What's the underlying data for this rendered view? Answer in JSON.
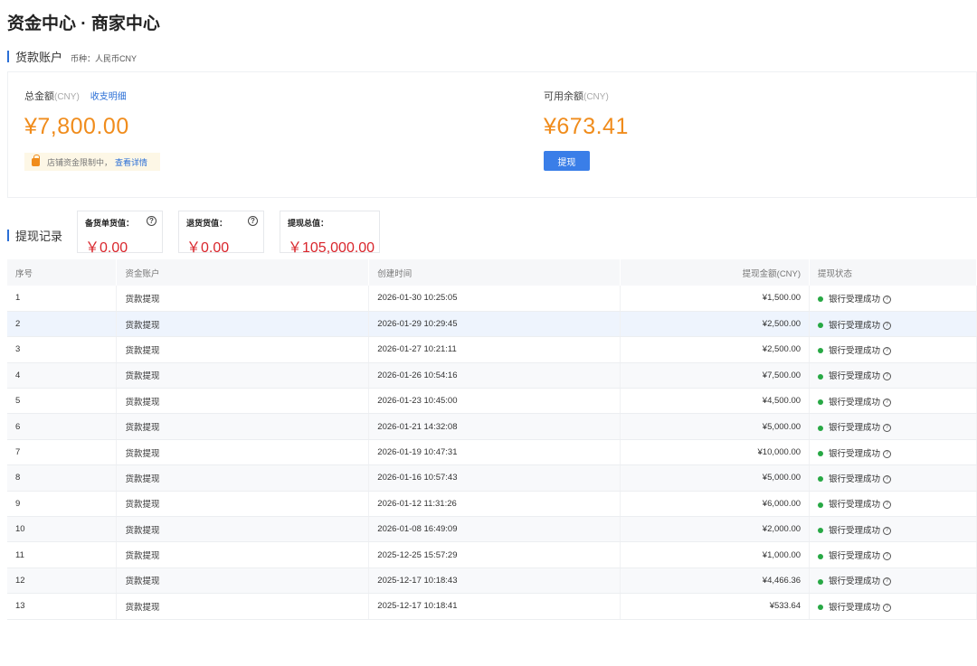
{
  "page": {
    "title": "资金中心 · 商家中心"
  },
  "account": {
    "section_label": "货款账户",
    "currency": "币种：人民币CNY",
    "total": {
      "label": "总金额",
      "unit": "(CNY)",
      "link": "收支明细",
      "amount": "¥7,800.00",
      "notice_text": "店铺资金限制中，",
      "notice_link": "查看详情"
    },
    "available": {
      "label": "可用余额",
      "unit": "(CNY)",
      "amount": "¥673.41",
      "button": "提现"
    }
  },
  "records": {
    "section_label": "提现记录",
    "stats": [
      {
        "label": "备货单货值：",
        "value": "￥0.00",
        "help": "?"
      },
      {
        "label": "退货货值：",
        "value": "￥0.00",
        "help": "?"
      },
      {
        "label": "提现总值：",
        "value": "￥105,000.00"
      }
    ],
    "columns": [
      "序号",
      "资金账户",
      "创建时间",
      "提现金额(CNY)",
      "提现状态"
    ],
    "status_help": "?",
    "rows": [
      {
        "no": "1",
        "account": "货款提现",
        "time": "2026-01-30 10:25:05",
        "amount": "¥1,500.00",
        "status": "银行受理成功"
      },
      {
        "no": "2",
        "account": "货款提现",
        "time": "2026-01-29 10:29:45",
        "amount": "¥2,500.00",
        "status": "银行受理成功"
      },
      {
        "no": "3",
        "account": "货款提现",
        "time": "2026-01-27 10:21:11",
        "amount": "¥2,500.00",
        "status": "银行受理成功"
      },
      {
        "no": "4",
        "account": "货款提现",
        "time": "2026-01-26 10:54:16",
        "amount": "¥7,500.00",
        "status": "银行受理成功"
      },
      {
        "no": "5",
        "account": "货款提现",
        "time": "2026-01-23 10:45:00",
        "amount": "¥4,500.00",
        "status": "银行受理成功"
      },
      {
        "no": "6",
        "account": "货款提现",
        "time": "2026-01-21 14:32:08",
        "amount": "¥5,000.00",
        "status": "银行受理成功"
      },
      {
        "no": "7",
        "account": "货款提现",
        "time": "2026-01-19 10:47:31",
        "amount": "¥10,000.00",
        "status": "银行受理成功"
      },
      {
        "no": "8",
        "account": "货款提现",
        "time": "2026-01-16 10:57:43",
        "amount": "¥5,000.00",
        "status": "银行受理成功"
      },
      {
        "no": "9",
        "account": "货款提现",
        "time": "2026-01-12 11:31:26",
        "amount": "¥6,000.00",
        "status": "银行受理成功"
      },
      {
        "no": "10",
        "account": "货款提现",
        "time": "2026-01-08 16:49:09",
        "amount": "¥2,000.00",
        "status": "银行受理成功"
      },
      {
        "no": "11",
        "account": "货款提现",
        "time": "2025-12-25 15:57:29",
        "amount": "¥1,000.00",
        "status": "银行受理成功"
      },
      {
        "no": "12",
        "account": "货款提现",
        "time": "2025-12-17 10:18:43",
        "amount": "¥4,466.36",
        "status": "银行受理成功"
      },
      {
        "no": "13",
        "account": "货款提现",
        "time": "2025-12-17 10:18:41",
        "amount": "¥533.64",
        "status": "银行受理成功"
      }
    ]
  }
}
